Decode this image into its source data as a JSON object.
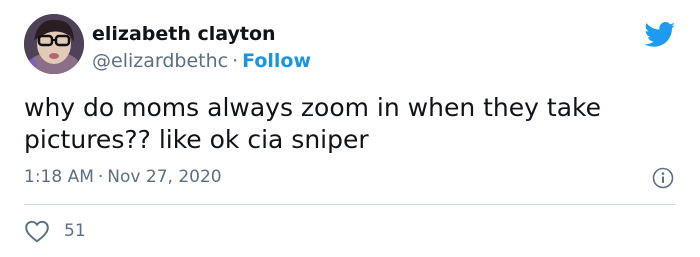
{
  "author": {
    "display_name": "elizabeth clayton",
    "handle": "@elizardbethc",
    "separator": "·",
    "follow_label": "Follow"
  },
  "tweet": {
    "text": "why do moms always zoom in when they take pictures?? like ok cia sniper",
    "time": "1:18 AM",
    "separator": "·",
    "date": "Nov 27, 2020"
  },
  "engagement": {
    "likes": "51"
  },
  "icons": {
    "brand": "twitter-bird-icon",
    "info": "info-icon",
    "like": "heart-icon"
  },
  "colors": {
    "accent": "#1b95e0",
    "text": "#0f1419",
    "secondary": "#5b7083",
    "divider": "#cfd9de"
  }
}
